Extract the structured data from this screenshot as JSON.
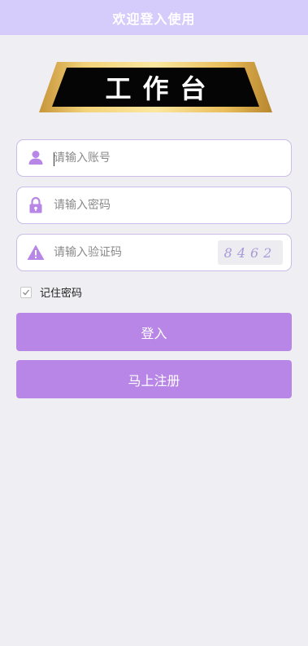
{
  "header": {
    "title": "欢迎登入使用"
  },
  "logo": {
    "text": "工作台"
  },
  "fields": {
    "account": {
      "placeholder": "请输入账号",
      "icon": "user-icon"
    },
    "password": {
      "placeholder": "请输入密码",
      "icon": "lock-icon"
    },
    "captcha": {
      "placeholder": "请输入验证码",
      "icon": "warning-icon",
      "code": "8462"
    }
  },
  "remember": {
    "label": "记住密码",
    "checked": true
  },
  "buttons": {
    "login": "登入",
    "register": "马上注册"
  },
  "colors": {
    "header_bg": "#d5ccfb",
    "accent": "#b886e6",
    "page_bg": "#efeff3",
    "field_border": "#cbbde6"
  }
}
